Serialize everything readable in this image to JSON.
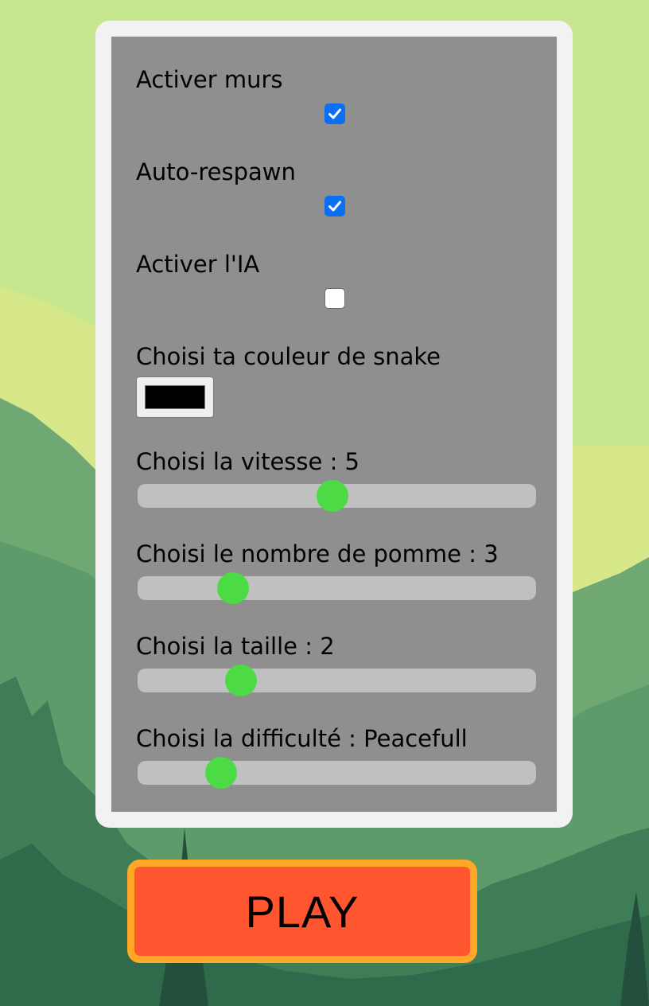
{
  "settings": {
    "walls": {
      "label": "Activer murs",
      "checked": true
    },
    "autorespawn": {
      "label": "Auto-respawn",
      "checked": true
    },
    "ai": {
      "label": "Activer l'IA",
      "checked": false
    },
    "color": {
      "label": "Choisi ta couleur de snake",
      "value": "#000000"
    },
    "speed": {
      "label": "Choisi la vitesse : 5",
      "level": 0.49
    },
    "apples": {
      "label": "Choisi le nombre de pomme : 3",
      "level": 0.24
    },
    "size": {
      "label": "Choisi la taille : 2",
      "level": 0.26
    },
    "difficulty": {
      "label": "Choisi la difficulté : Peacefull",
      "level": 0.21
    }
  },
  "play_button": {
    "label": "PLAY"
  },
  "colors": {
    "checkbox_accent": "#0b6ff3",
    "slider_thumb": "#4ddb45",
    "play_fill": "#ff5630",
    "play_border": "#ffa726",
    "panel": "#8f8f8f"
  },
  "icons": [
    "checkmark-icon"
  ]
}
